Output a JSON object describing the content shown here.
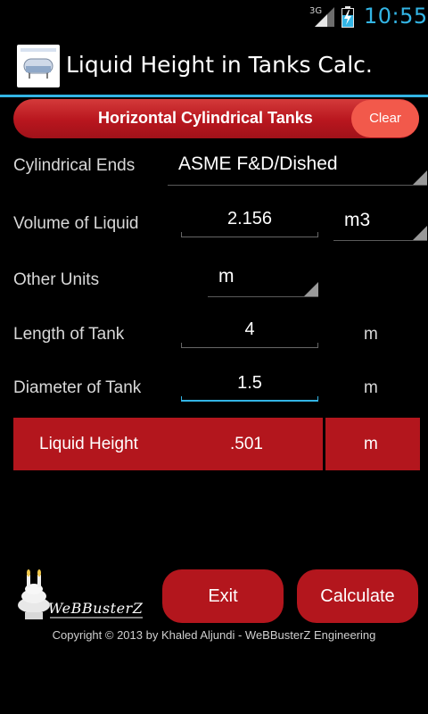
{
  "status_bar": {
    "network": "3G",
    "time": "10:55",
    "icons": [
      "signal-icon",
      "battery-charging-icon"
    ]
  },
  "app_bar": {
    "title": "Liquid Height in Tanks Calc.",
    "icon": "tank-app-icon"
  },
  "header": {
    "title": "Horizontal Cylindrical Tanks",
    "clear_label": "Clear"
  },
  "form": {
    "cylindrical_ends": {
      "label": "Cylindrical Ends",
      "selected": "ASME F&D/Dished"
    },
    "volume": {
      "label": "Volume of Liquid",
      "value": "2.156",
      "unit": "m3"
    },
    "other_units": {
      "label": "Other Units",
      "selected": "m"
    },
    "length": {
      "label": "Length of Tank",
      "value": "4",
      "unit": "m"
    },
    "diameter": {
      "label": "Diameter of Tank",
      "value": "1.5",
      "unit": "m"
    }
  },
  "result": {
    "label": "Liquid Height",
    "value": ".501",
    "unit": "m"
  },
  "footer": {
    "logo_text": "WeBBusterZ",
    "exit_label": "Exit",
    "calculate_label": "Calculate",
    "copyright": "Copyright © 2013 by Khaled Aljundi - WeBBusterZ Engineering"
  },
  "colors": {
    "accent_blue": "#33b5e5",
    "brand_red": "#b3161d",
    "clear_orange": "#f2594b"
  }
}
